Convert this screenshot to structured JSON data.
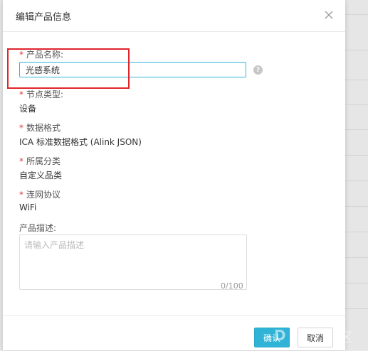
{
  "dialog": {
    "title": "编辑产品信息",
    "icons": {
      "close": "close-icon",
      "help": "question-icon"
    }
  },
  "fields": {
    "name": {
      "label": "产品名称:",
      "value": "光感系统",
      "required": true
    },
    "node_type": {
      "label": "节点类型:",
      "value": "设备",
      "required": true
    },
    "data_format": {
      "label": "数据格式",
      "value": "ICA 标准数据格式 (Alink JSON)",
      "required": true
    },
    "category": {
      "label": "所属分类",
      "value": "自定义品类",
      "required": true
    },
    "network": {
      "label": "连网协议",
      "value": "WiFi",
      "required": true
    },
    "description": {
      "label": "产品描述:",
      "placeholder": "请输入产品描述",
      "counter": "0/100"
    }
  },
  "footer": {
    "ok_label": "确认",
    "cancel_label": "取消"
  },
  "colors": {
    "accent": "#2fb3d6",
    "required_star": "#e4393c",
    "highlight": "#e0242b"
  }
}
